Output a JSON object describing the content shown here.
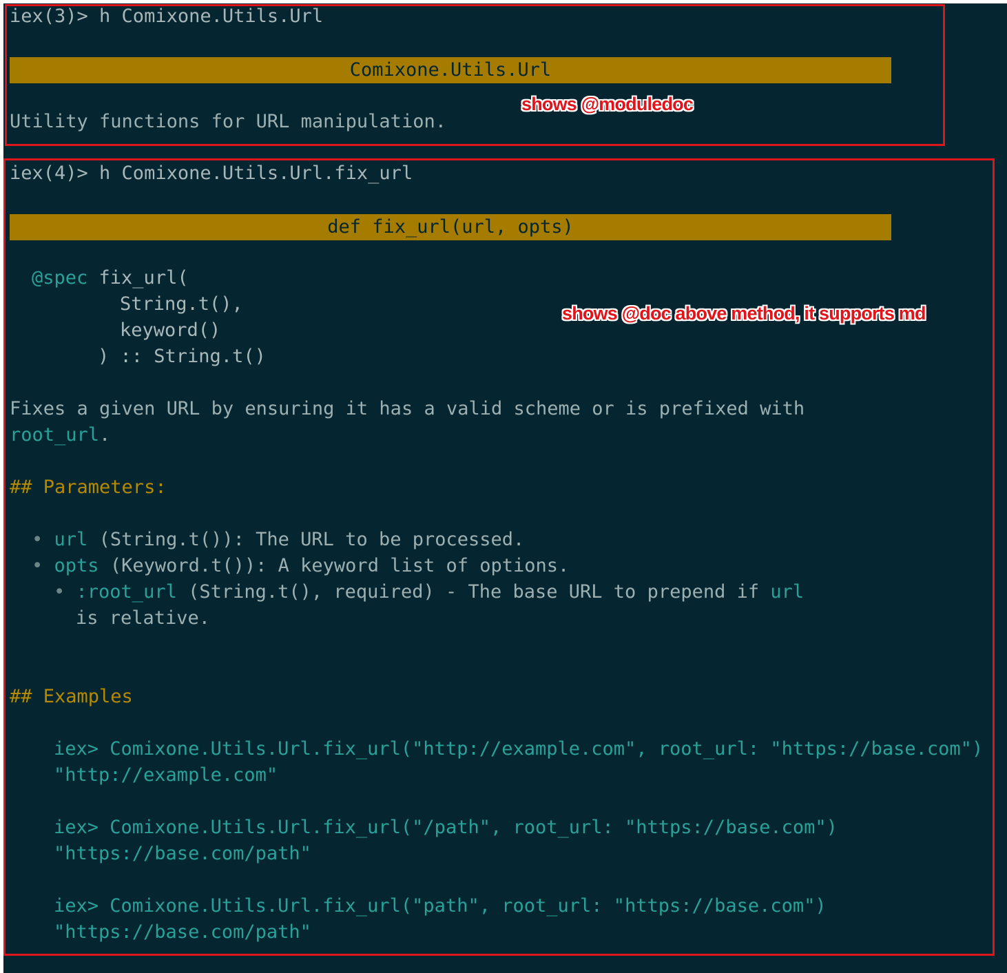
{
  "block1": {
    "prompt": "iex(3)> h Comixone.Utils.Url",
    "bar_title": "Comixone.Utils.Url",
    "moduledoc": "Utility functions for URL manipulation.",
    "annotation": "shows @moduledoc"
  },
  "block2": {
    "prompt": "iex(4)> h Comixone.Utils.Url.fix_url",
    "bar_title": "def fix_url(url, opts)",
    "annotation": "shows @doc above method, it supports md",
    "spec": {
      "keyword": "@spec",
      "line1": " fix_url(",
      "line2": "String.t(),",
      "line3": "keyword()",
      "line4": ") :: String.t()"
    },
    "description": {
      "line1": "Fixes a given URL by ensuring it has a valid scheme or is prefixed with",
      "code": "root_url",
      "line2_suffix": "."
    },
    "params_heading": "## Parameters:",
    "params": [
      {
        "bullet": "•",
        "name": "url",
        "text": " (String.t()): The URL to be processed."
      },
      {
        "bullet": "•",
        "name": "opts",
        "text": " (Keyword.t()): A keyword list of options."
      }
    ],
    "subparam": {
      "bullet": "•",
      "name": ":root_url",
      "text": " (String.t(), required) - The base URL to prepend if ",
      "code": "url",
      "continuation": "is relative."
    },
    "examples_heading": "## Examples",
    "examples": [
      {
        "call": "iex> Comixone.Utils.Url.fix_url(\"http://example.com\", root_url: \"https://base.com\")",
        "result": "\"http://example.com\""
      },
      {
        "call": "iex> Comixone.Utils.Url.fix_url(\"/path\", root_url: \"https://base.com\")",
        "result": "\"https://base.com/path\""
      },
      {
        "call": "iex> Comixone.Utils.Url.fix_url(\"path\", root_url: \"https://base.com\")",
        "result": "\"https://base.com/path\""
      }
    ]
  },
  "colors": {
    "background": "#052631",
    "text": "#9cafb1",
    "accent_green": "#2aa198",
    "heading_yellow": "#b58900",
    "bar": "#a67c00",
    "annotation_red": "#e0141b"
  }
}
